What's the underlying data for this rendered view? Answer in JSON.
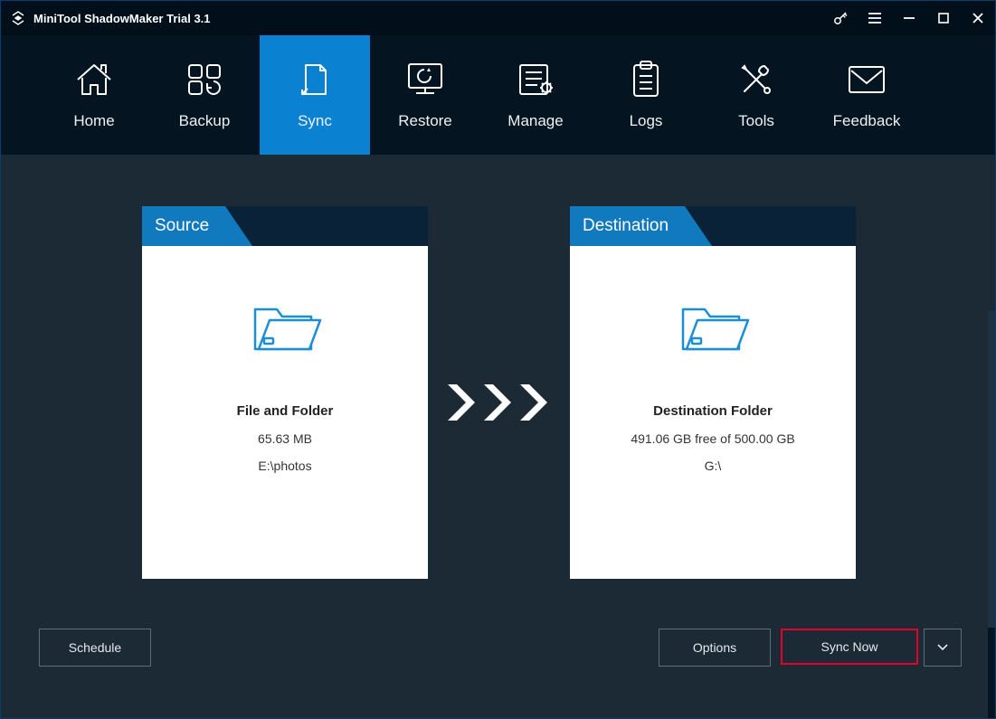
{
  "title": "MiniTool ShadowMaker Trial 3.1",
  "nav": {
    "home": "Home",
    "backup": "Backup",
    "sync": "Sync",
    "restore": "Restore",
    "manage": "Manage",
    "logs": "Logs",
    "tools": "Tools",
    "feedback": "Feedback"
  },
  "source": {
    "title": "Source",
    "heading": "File and Folder",
    "size": "65.63 MB",
    "path": "E:\\photos"
  },
  "destination": {
    "title": "Destination",
    "heading": "Destination Folder",
    "size": "491.06 GB free of 500.00 GB",
    "path": "G:\\"
  },
  "buttons": {
    "schedule": "Schedule",
    "options": "Options",
    "syncnow": "Sync Now"
  }
}
